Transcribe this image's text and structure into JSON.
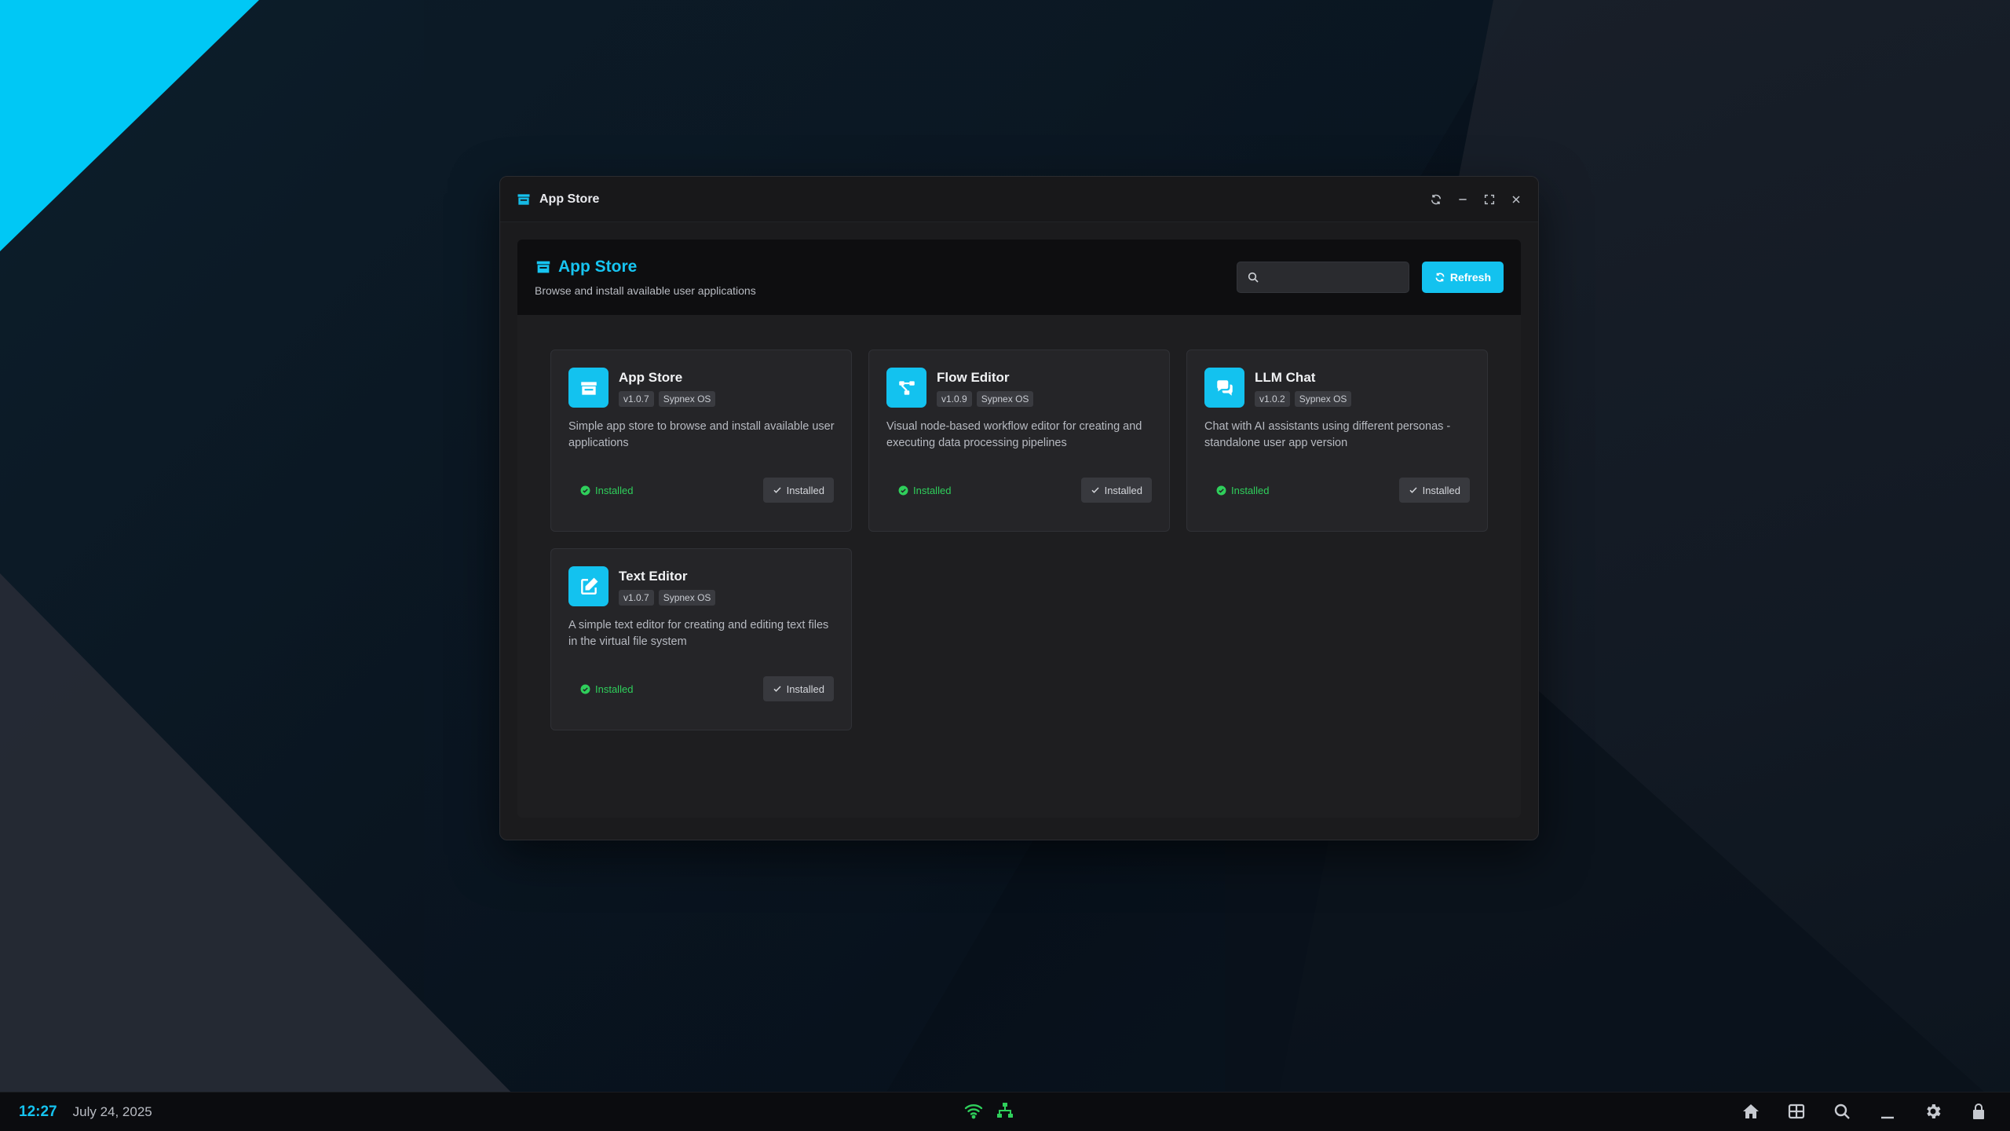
{
  "window": {
    "title": "App Store",
    "controls": [
      "refresh-icon",
      "minimize-icon",
      "maximize-icon",
      "close-icon"
    ]
  },
  "header": {
    "title": "App Store",
    "subtitle": "Browse and install available user applications",
    "search_placeholder": "",
    "refresh_label": "Refresh"
  },
  "apps": [
    {
      "name": "App Store",
      "version": "v1.0.7",
      "publisher": "Sypnex OS",
      "description": "Simple app store to browse and install available user applications",
      "status": "Installed",
      "button": "Installed",
      "icon": "store-icon"
    },
    {
      "name": "Flow Editor",
      "version": "v1.0.9",
      "publisher": "Sypnex OS",
      "description": "Visual node-based workflow editor for creating and executing data processing pipelines",
      "status": "Installed",
      "button": "Installed",
      "icon": "workflow-icon"
    },
    {
      "name": "LLM Chat",
      "version": "v1.0.2",
      "publisher": "Sypnex OS",
      "description": "Chat with AI assistants using different personas - standalone user app version",
      "status": "Installed",
      "button": "Installed",
      "icon": "chat-icon"
    },
    {
      "name": "Text Editor",
      "version": "v1.0.7",
      "publisher": "Sypnex OS",
      "description": "A simple text editor for creating and editing text files in the virtual file system",
      "status": "Installed",
      "button": "Installed",
      "icon": "edit-icon"
    }
  ],
  "taskbar": {
    "time": "12:27",
    "date": "July 24, 2025",
    "tray_icons": [
      "wifi-icon",
      "network-icon"
    ],
    "right_icons": [
      "home-icon",
      "grid-icon",
      "search-icon",
      "minimize-all-icon",
      "settings-icon",
      "lock-icon"
    ]
  },
  "colors": {
    "accent": "#13c2ef",
    "success": "#2fcf5b"
  }
}
